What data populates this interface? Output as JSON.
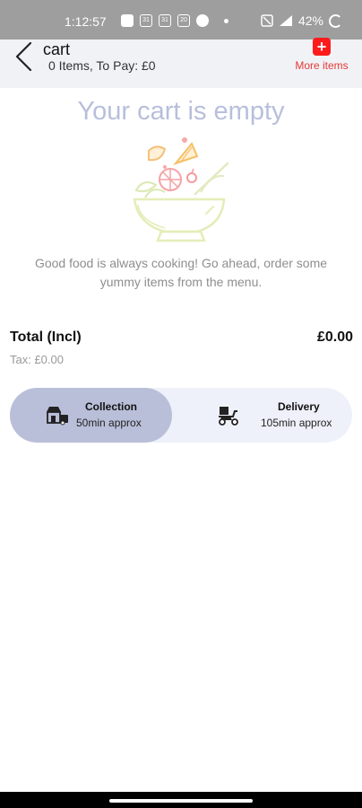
{
  "status_bar": {
    "time": "1:12:57",
    "battery": "42%",
    "notification_icons": [
      "message-icon",
      "app-icon-31",
      "app-icon-31",
      "app-icon-20",
      "pinterest-icon"
    ]
  },
  "header": {
    "title": "cart",
    "subtitle": "0  Items, To Pay:  £0",
    "more_items_label": "More items",
    "more_items_icon": "+"
  },
  "empty_state": {
    "title": "Your cart is empty",
    "message": "Good food is always cooking! Go ahead, order some yummy items from the menu.",
    "illustration": "salad-bowl-icon"
  },
  "summary": {
    "total_label": "Total (Incl)",
    "total_value": "£0.00",
    "tax": "Tax: £0.00"
  },
  "order_mode": {
    "selected": "Collection",
    "options": [
      {
        "name": "Collection",
        "time": "50min approx",
        "icon": "store-icon"
      },
      {
        "name": "Delivery",
        "time": "105min approx",
        "icon": "delivery-scooter-icon"
      }
    ]
  },
  "colors": {
    "accent_red": "#ff1b1b",
    "header_bg": "#f1f2f6",
    "empty_title": "#b8bfdc",
    "selected_mode_bg": "#b9bfd9",
    "toggle_bg": "#eef1f9"
  }
}
